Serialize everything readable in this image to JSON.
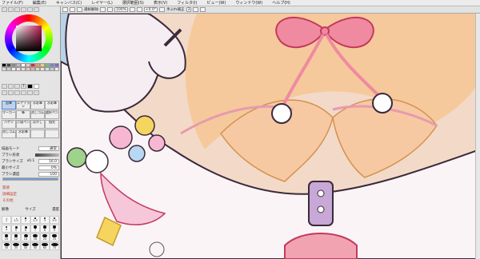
{
  "menubar": {
    "items": [
      "ファイル(F)",
      "編集(E)",
      "キャンバス(C)",
      "レイヤー(L)",
      "選択範囲(S)",
      "表示(V)",
      "フィルタ(I)",
      "ビュー(W)",
      "ウィンドウ(W)",
      "ヘルプ(H)"
    ]
  },
  "toolbar": {
    "label_select_release": "選択解除",
    "zoom": "100%",
    "angle": "+0.0°",
    "stabilizer_label": "手ぶれ補正",
    "stabilizer_value": "3"
  },
  "palette": {
    "accent": "#c21a55"
  },
  "tools": {
    "items": [
      "鉛筆",
      "エアブラシ",
      "水彩筆",
      "水彩筆",
      "マーカー",
      "筆",
      "消しゴム",
      "選択ペン",
      "バケツ",
      "二値ペン",
      "ぼかし",
      "指先",
      "消しゴム",
      "水彩筆",
      "",
      ""
    ]
  },
  "props": {
    "blend_label": "描画モード",
    "blend_value": "通常",
    "shape_label": "ブラシ形状",
    "size_label": "ブラシサイズ",
    "size_multiplier": "x0.1",
    "size_value": "16.0",
    "min_size_label": "最小サイズ",
    "min_size_value": "0%",
    "density_label": "ブラシ濃度",
    "density_value": "100"
  },
  "sections": {
    "texture": "質感",
    "detail": "詳細設定",
    "other": "その他"
  },
  "brush_sizes": {
    "header_a": "解像",
    "header_b": "サイズ",
    "header_c": "濃度",
    "labels": [
      "1",
      "1.5",
      "2",
      "2.3",
      "3",
      "3.5",
      "4",
      "5",
      "6",
      "7",
      "8",
      "9",
      "10",
      "12",
      "14",
      "16",
      "20",
      "25",
      "30",
      "35",
      "40",
      "50",
      "60",
      "70"
    ]
  }
}
